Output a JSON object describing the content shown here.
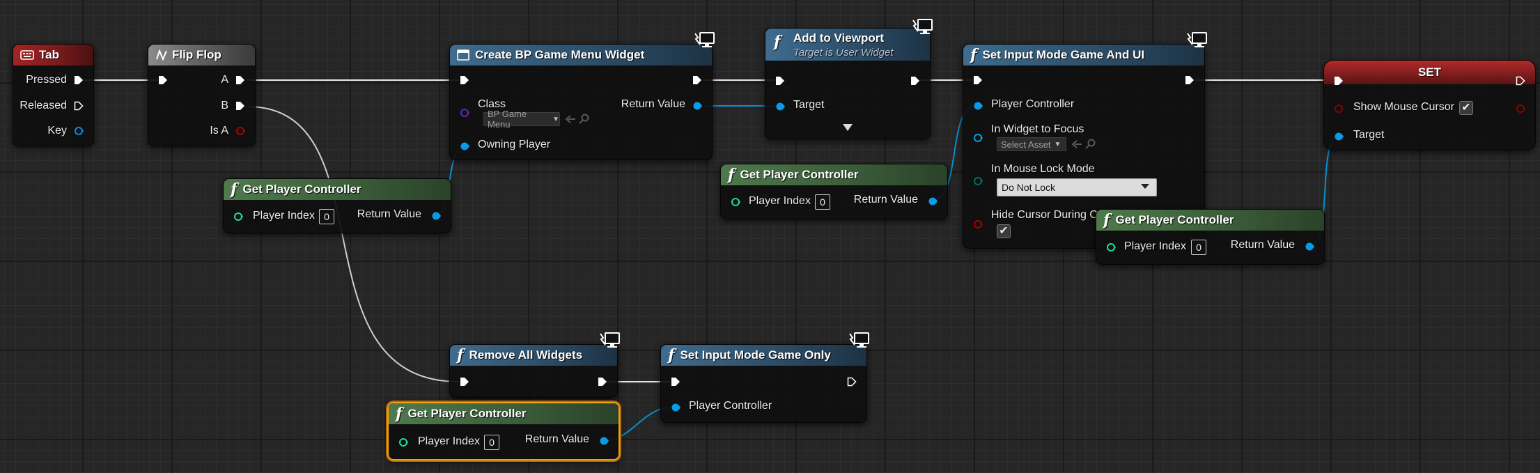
{
  "nodes": {
    "tab": {
      "title": "Tab",
      "pressed": "Pressed",
      "released": "Released",
      "key": "Key"
    },
    "flip_flop": {
      "title": "Flip Flop",
      "a": "A",
      "b": "B",
      "is_a": "Is A"
    },
    "create_widget": {
      "title": "Create BP Game Menu Widget",
      "class_label": "Class",
      "class_value": "BP Game Menu",
      "owning_player": "Owning Player",
      "return_value": "Return Value"
    },
    "add_to_viewport": {
      "title": "Add to Viewport",
      "subtitle": "Target is User Widget",
      "target": "Target"
    },
    "set_input_game_ui": {
      "title": "Set Input Mode Game And UI",
      "player_controller": "Player Controller",
      "widget_focus": "In Widget to Focus",
      "widget_focus_value": "Select Asset",
      "mouse_lock": "In Mouse Lock Mode",
      "mouse_lock_value": "Do Not Lock",
      "hide_cursor": "Hide Cursor During Capture",
      "hide_cursor_checked": true
    },
    "set_var": {
      "title": "SET",
      "show_mouse_cursor": "Show Mouse Cursor",
      "show_mouse_cursor_checked": true,
      "target": "Target"
    },
    "get_pc_1": {
      "title": "Get Player Controller",
      "player_index": "Player Index",
      "index_value": "0",
      "return_value": "Return Value"
    },
    "get_pc_2": {
      "title": "Get Player Controller",
      "player_index": "Player Index",
      "index_value": "0",
      "return_value": "Return Value"
    },
    "get_pc_3": {
      "title": "Get Player Controller",
      "player_index": "Player Index",
      "index_value": "0",
      "return_value": "Return Value"
    },
    "get_pc_4": {
      "title": "Get Player Controller",
      "player_index": "Player Index",
      "index_value": "0",
      "return_value": "Return Value"
    },
    "remove_all_widgets": {
      "title": "Remove All Widgets"
    },
    "set_input_game_only": {
      "title": "Set Input Mode Game Only",
      "player_controller": "Player Controller"
    }
  },
  "colors": {
    "exec": "#ffffff",
    "object_pin": "#00a8f4",
    "int_pin": "#1edba4",
    "bool_pin": "#8c0000",
    "class_pin": "#5b00c4",
    "byte_pin": "#006b5a",
    "exec_wire": "#ffffff",
    "object_wire": "#0a8fd0",
    "selected_outline": "#f0a010"
  },
  "icons": {
    "function": "function-icon",
    "event": "key-event-icon",
    "flipflop": "flip-flop-icon",
    "widget": "widget-icon",
    "net": "monitor-icon",
    "latent_arrow": "chevron-down-icon"
  }
}
